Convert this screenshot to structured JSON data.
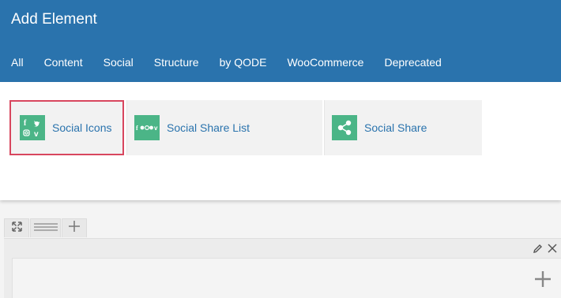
{
  "header": {
    "title": "Add Element",
    "tabs": [
      "All",
      "Content",
      "Social",
      "Structure",
      "by QODE",
      "WooCommerce",
      "Deprecated"
    ]
  },
  "elements": [
    {
      "label": "Social Icons",
      "icon": "social-icons-icon"
    },
    {
      "label": "Social Share List",
      "icon": "social-share-list-icon"
    },
    {
      "label": "Social Share",
      "icon": "share-icon"
    }
  ],
  "colors": {
    "header_bg": "#2a73ad",
    "accent": "#4bb587",
    "link": "#2a73ad",
    "selected_border": "#d8465e"
  },
  "toolbar": {
    "icons": [
      "fullscreen-icon",
      "row-layout-icon",
      "add-icon"
    ]
  },
  "row": {
    "icons": [
      "pencil-icon",
      "close-icon",
      "add-element-icon"
    ]
  }
}
